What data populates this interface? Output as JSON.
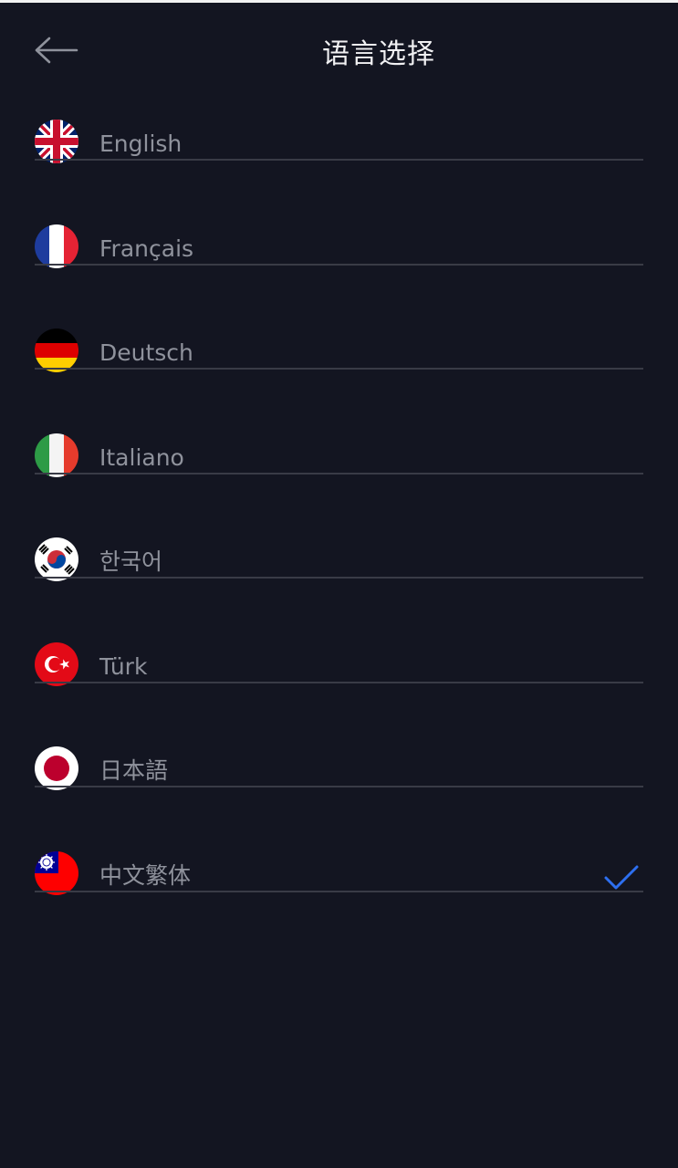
{
  "header": {
    "title": "语言选择",
    "back_icon": "back-arrow-icon"
  },
  "colors": {
    "background": "#131521",
    "title": "#f0f0f2",
    "label": "#8f929c",
    "divider": "#393b46",
    "check": "#2d6ff0"
  },
  "languages": [
    {
      "label": "English",
      "flag": "uk-flag-icon",
      "selected": false
    },
    {
      "label": "Français",
      "flag": "france-flag-icon",
      "selected": false
    },
    {
      "label": "Deutsch",
      "flag": "germany-flag-icon",
      "selected": false
    },
    {
      "label": "Italiano",
      "flag": "italy-flag-icon",
      "selected": false
    },
    {
      "label": "한국어",
      "flag": "south-korea-flag-icon",
      "selected": false
    },
    {
      "label": "Türk",
      "flag": "turkey-flag-icon",
      "selected": false
    },
    {
      "label": "日本語",
      "flag": "japan-flag-icon",
      "selected": false
    },
    {
      "label": "中文繁体",
      "flag": "taiwan-flag-icon",
      "selected": true
    }
  ]
}
